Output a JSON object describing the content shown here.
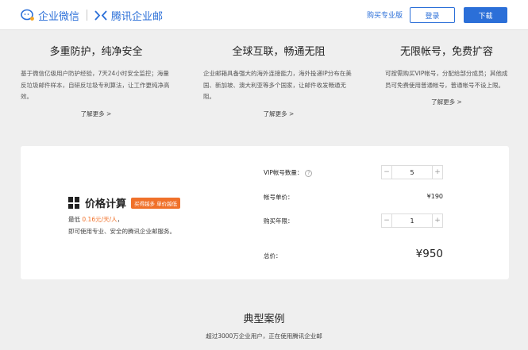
{
  "header": {
    "brand_left": "企业微信",
    "brand_right": "腾讯企业邮",
    "buy_label": "购买专业版",
    "login_label": "登录",
    "download_label": "下载"
  },
  "features": [
    {
      "title": "多重防护，纯净安全",
      "desc": "基于微信亿级用户防护经验，7天24小时安全监控；海量反垃圾邮件样本，自研反垃圾专利算法，让工作更纯净高效。",
      "more": "了解更多 >"
    },
    {
      "title": "全球互联，畅通无阻",
      "desc": "企业邮箱具备强大的海外连接能力，海外投递IP分布在美国、新加坡、澳大利亚等多个国家，让邮件收发畅通无阻。",
      "more": "了解更多 >"
    },
    {
      "title": "无限帐号，免费扩容",
      "desc": "可按需购买VIP帐号，分配给部分成员；其他成员可免费使用普通帐号，普通帐号不设上限。",
      "more": "了解更多 >"
    }
  ],
  "pricing": {
    "title": "价格计算",
    "tag": "买得越多 单价越低",
    "line1_prefix": "最低 ",
    "line1_highlight": "0.16元/天/人",
    "line1_suffix": "，",
    "line2": "即可使用专业、安全的腾讯企业邮服务。",
    "vip_label": "VIP帐号数量：",
    "vip_value": "5",
    "unit_label": "帐号单价：",
    "unit_price": "¥190",
    "years_label": "购买年限：",
    "years_value": "1",
    "total_label": "总价：",
    "total_price": "¥950"
  },
  "cases": {
    "title": "典型案例",
    "subtitle": "超过3000万企业用户，正在使用腾讯企业邮"
  }
}
